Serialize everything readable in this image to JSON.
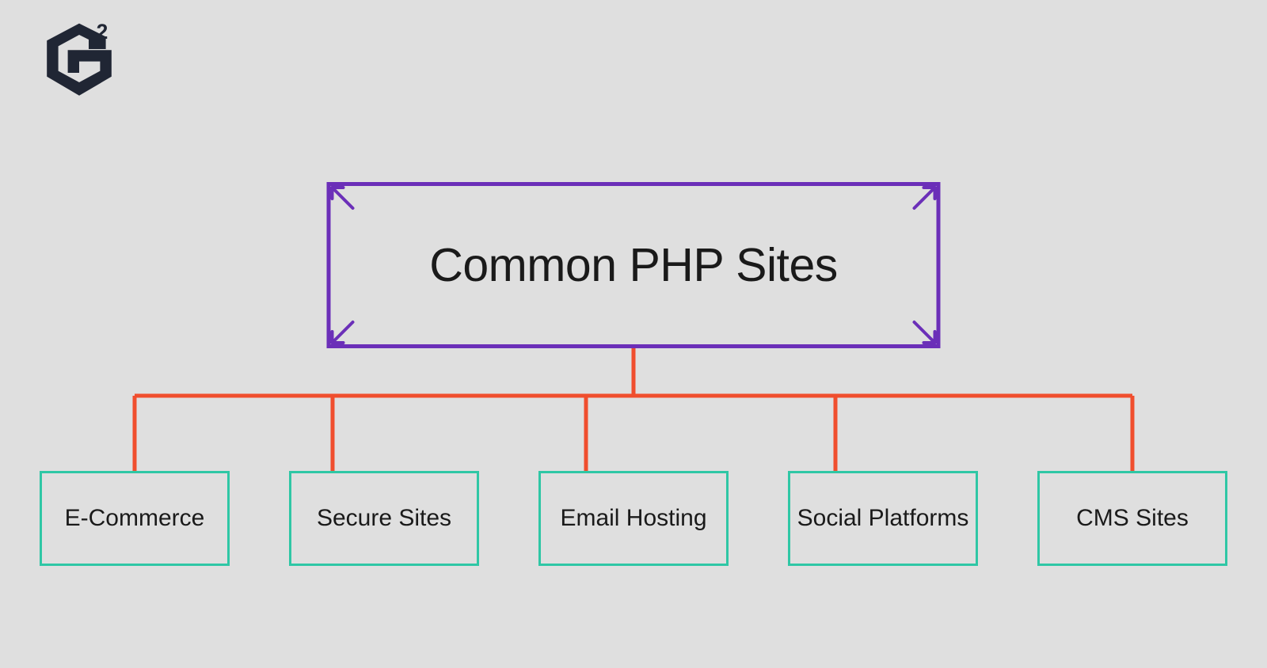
{
  "logo": {
    "name": "G2"
  },
  "diagram": {
    "title": "Common PHP Sites",
    "children": [
      {
        "label": "E-Commerce"
      },
      {
        "label": "Secure Sites"
      },
      {
        "label": "Email Hosting"
      },
      {
        "label": "Social Platforms"
      },
      {
        "label": "CMS Sites"
      }
    ]
  },
  "colors": {
    "background": "#dfdfdf",
    "title_border": "#6b2fb8",
    "child_border": "#2fc7a5",
    "connector": "#f04e2e",
    "text": "#1a1a1a",
    "logo": "#202634"
  }
}
